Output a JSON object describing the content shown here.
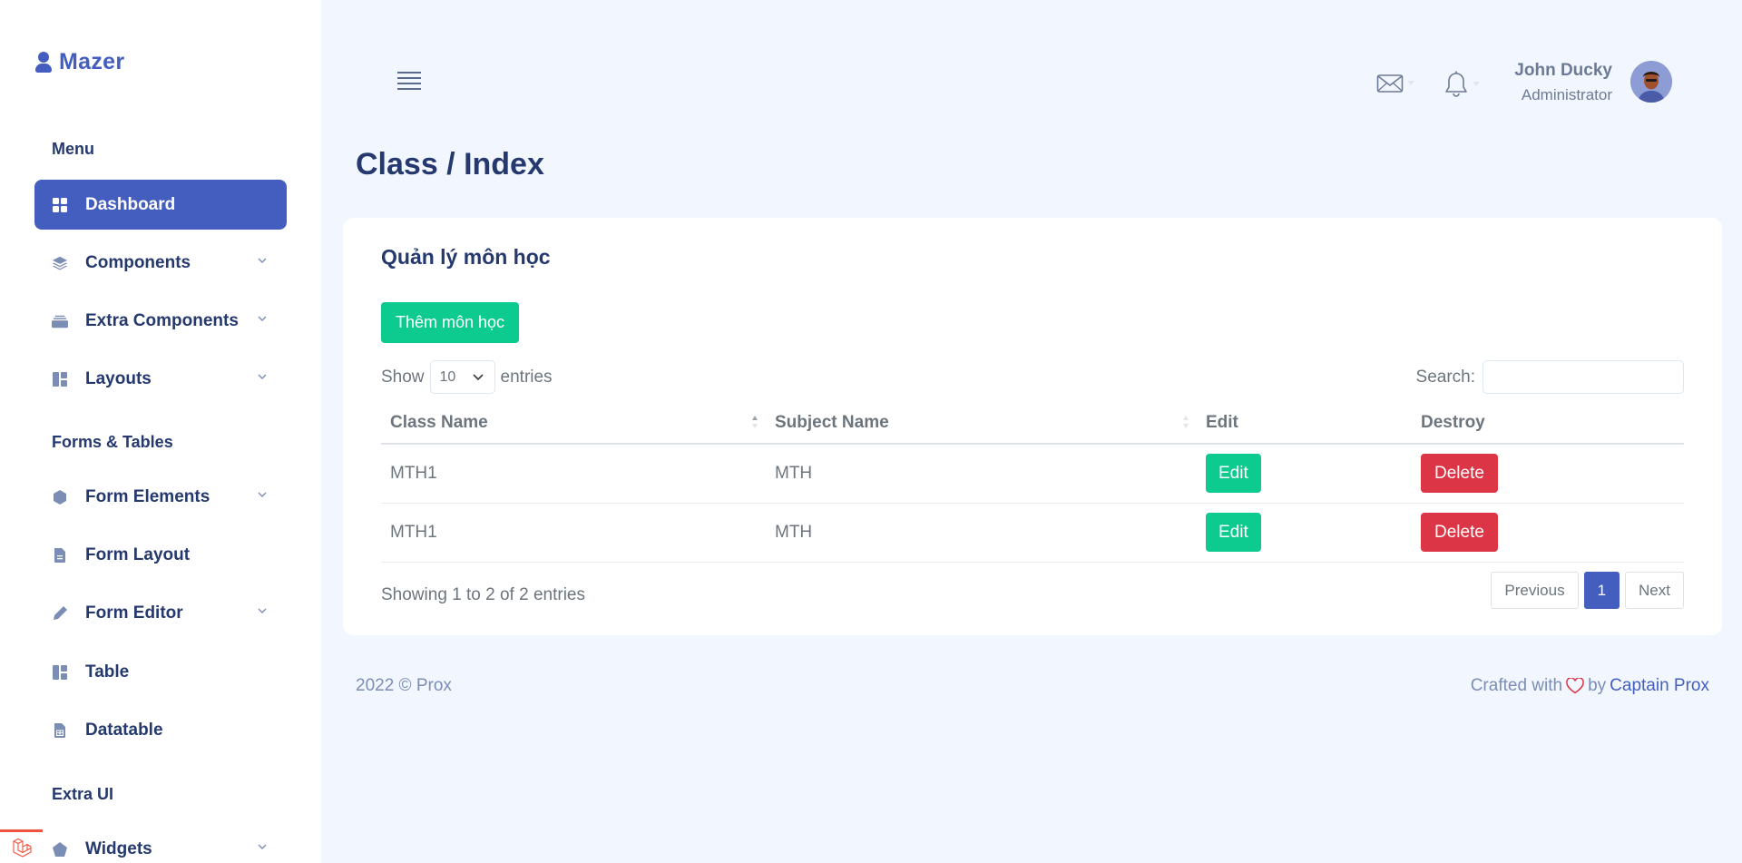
{
  "app": {
    "logo_text": "Mazer"
  },
  "sidebar": {
    "sections": [
      {
        "title": "Menu"
      },
      {
        "title": "Forms & Tables"
      },
      {
        "title": "Extra UI"
      }
    ],
    "items": [
      {
        "label": "Dashboard",
        "icon": "grid-icon",
        "active": true
      },
      {
        "label": "Components",
        "icon": "stack-icon",
        "has_submenu": true
      },
      {
        "label": "Extra Components",
        "icon": "collection-icon",
        "has_submenu": true
      },
      {
        "label": "Layouts",
        "icon": "layout-icon",
        "has_submenu": true
      },
      {
        "label": "Form Elements",
        "icon": "hexagon-icon",
        "has_submenu": true
      },
      {
        "label": "Form Layout",
        "icon": "file-text-icon"
      },
      {
        "label": "Form Editor",
        "icon": "pen-icon",
        "has_submenu": true
      },
      {
        "label": "Table",
        "icon": "layout-icon"
      },
      {
        "label": "Datatable",
        "icon": "file-spreadsheet-icon"
      },
      {
        "label": "Widgets",
        "icon": "pentagon-icon",
        "has_submenu": true
      }
    ]
  },
  "header": {
    "user": {
      "name": "John Ducky",
      "role": "Administrator"
    }
  },
  "page": {
    "title": "Class / Index"
  },
  "card": {
    "title": "Quản lý môn học",
    "add_button": "Thêm môn học",
    "length": {
      "show": "Show",
      "value": "10",
      "entries": "entries"
    },
    "search_label": "Search:",
    "columns": [
      "Class Name",
      "Subject Name",
      "Edit",
      "Destroy"
    ],
    "rows": [
      {
        "class_name": "MTH1",
        "subject_name": "MTH",
        "edit": "Edit",
        "destroy": "Delete"
      },
      {
        "class_name": "MTH1",
        "subject_name": "MTH",
        "edit": "Edit",
        "destroy": "Delete"
      }
    ],
    "info": "Showing 1 to 2 of 2 entries",
    "pager": {
      "previous": "Previous",
      "current": "1",
      "next": "Next"
    }
  },
  "footer": {
    "left": "2022 © Prox",
    "crafted": "Crafted with",
    "by": "by",
    "author": "Captain Prox"
  },
  "colors": {
    "primary": "#435ebe",
    "success": "#0dcb8f",
    "danger": "#dc3545",
    "background": "#f2f7ff"
  }
}
